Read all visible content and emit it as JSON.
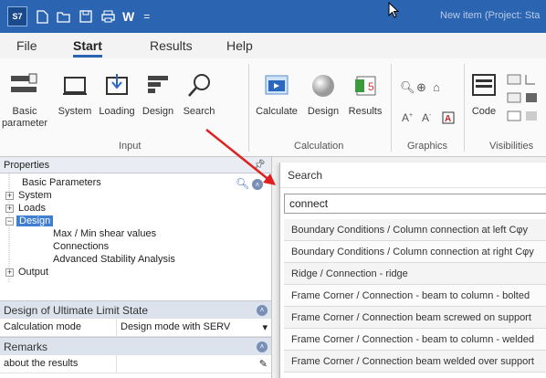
{
  "titlebar": {
    "app_icon_text": "S7",
    "quick_access": [
      "new-file-icon",
      "open-folder-icon",
      "save-icon",
      "print-icon"
    ],
    "quick_w": "W",
    "more": "=",
    "title": "New item (Project: Sta"
  },
  "tabs": [
    {
      "label": "File"
    },
    {
      "label": "Start"
    },
    {
      "label": "Results"
    },
    {
      "label": "Help"
    }
  ],
  "ribbon": {
    "input_group": {
      "label": "Input",
      "buttons": [
        {
          "label": "Basic\nparameter",
          "icon": "basic-parameter-icon"
        },
        {
          "label": "System",
          "icon": "system-icon"
        },
        {
          "label": "Loading",
          "icon": "loading-icon"
        },
        {
          "label": "Design",
          "icon": "design-icon"
        },
        {
          "label": "Search",
          "icon": "search-icon"
        }
      ]
    },
    "calculation_group": {
      "label": "Calculation",
      "buttons": [
        {
          "label": "Calculate",
          "icon": "calculate-icon"
        },
        {
          "label": "Design",
          "icon": "design-sphere-icon"
        },
        {
          "label": "Results",
          "icon": "results-icon"
        }
      ]
    },
    "graphics_group": {
      "label": "Graphics",
      "font_up": "A",
      "font_down": "A"
    },
    "visibilities_group": {
      "label": "Visibilities",
      "code_label": "Code"
    }
  },
  "properties": {
    "header": "Properties",
    "pin": "⍒",
    "tree": [
      {
        "label": "Basic Parameters"
      },
      {
        "label": "System"
      },
      {
        "label": "Loads"
      },
      {
        "label": "Design"
      },
      {
        "label": "Max / Min shear values"
      },
      {
        "label": "Connections"
      },
      {
        "label": "Advanced Stability Analysis"
      },
      {
        "label": "Output"
      }
    ]
  },
  "design_uls": {
    "header": "Design of Ultimate Limit State",
    "rows": [
      {
        "key": "Calculation mode",
        "value": "Design mode with SERV"
      }
    ]
  },
  "remarks": {
    "header": "Remarks",
    "rows": [
      {
        "key": "about the results",
        "value": ""
      }
    ]
  },
  "search": {
    "title": "Search",
    "query": "connect",
    "results": [
      "Boundary Conditions / Column connection at left Cφy",
      "Boundary Conditions / Column connection at right Cφy",
      "Ridge / Connection - ridge",
      "Frame Corner / Connection - beam to column - bolted",
      "Frame Corner / Connection beam screwed on support",
      "Frame Corner / Connection - beam to column - welded",
      "Frame Corner / Connection beam welded over support"
    ]
  },
  "colors": {
    "titlebar": "#2b65b1",
    "selection": "#3f7ed1",
    "arrow": "#e02020"
  }
}
